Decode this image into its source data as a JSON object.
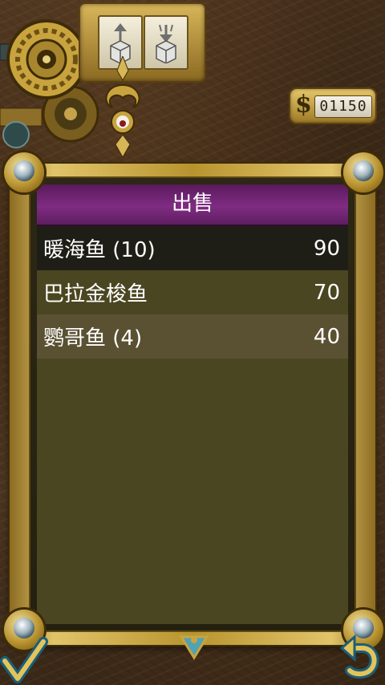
{
  "shop": {
    "title": "出售",
    "money": "01150",
    "currency_icon": "dollar-sign-icon"
  },
  "items": [
    {
      "name": "暖海鱼 (10)",
      "price": "90"
    },
    {
      "name": "巴拉金梭鱼",
      "price": "70"
    },
    {
      "name": "鹦哥鱼 (4)",
      "price": "40"
    }
  ],
  "icons": {
    "confirm": "checkmark-icon",
    "back": "return-arrow-icon",
    "scroll_down": "chevron-down-icon",
    "buy": "crate-arrow-up-icon",
    "sell": "crate-arrow-down-icon"
  },
  "colors": {
    "header_purple": "#7f2c82",
    "panel_olive": "#4a4621",
    "selected_row": "#1f1e16",
    "brass": "#c9a43e"
  }
}
